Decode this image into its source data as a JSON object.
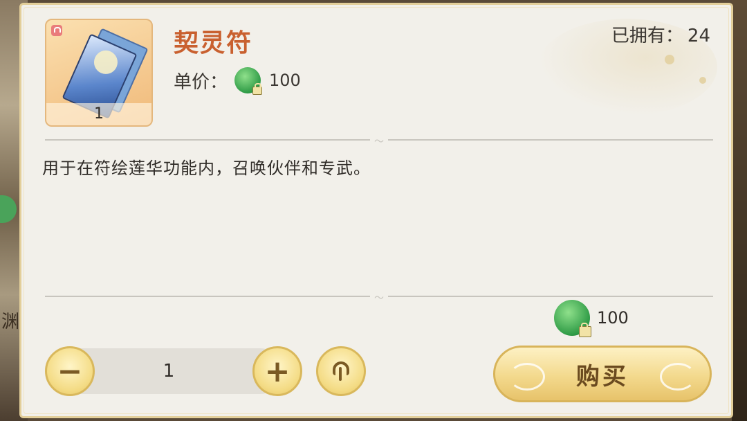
{
  "background": {
    "side_text": "渊"
  },
  "item": {
    "name": "契灵符",
    "icon": "talisman-icon",
    "count": "1"
  },
  "owned": {
    "label": "已拥有：",
    "value": "24"
  },
  "price": {
    "label": "单价：",
    "currency_icon": "jade-coin-locked-icon",
    "value": "100"
  },
  "description": "用于在符绘莲华功能内，召唤伙伴和专武。",
  "total_cost": {
    "currency_icon": "jade-coin-locked-icon",
    "value": "100"
  },
  "quantity": {
    "value": "1",
    "minus_label": "−",
    "plus_label": "+"
  },
  "buy_button": {
    "label": "购买"
  },
  "colors": {
    "item_name": "#c9602f",
    "panel_bg": "#f2f0ea",
    "button_gold": "#f3d98d",
    "currency_green": "#2f9b46"
  }
}
